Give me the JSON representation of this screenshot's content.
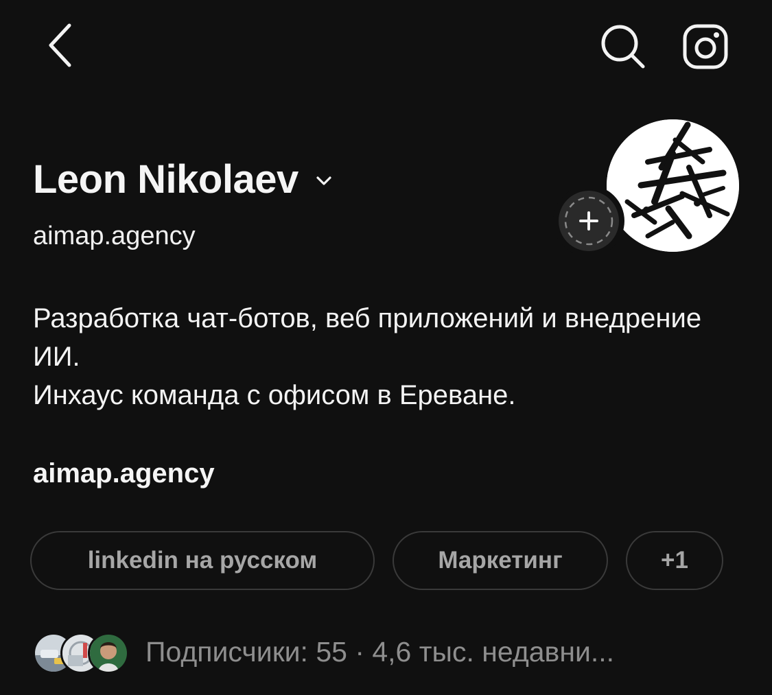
{
  "header": {
    "back_icon": "chevron-left-icon",
    "search_icon": "search-icon",
    "instagram_icon": "instagram-icon"
  },
  "profile": {
    "name": "Leon Nikolaev",
    "username": "aimap.agency",
    "add_story_icon": "plus-icon"
  },
  "bio": {
    "lines": [
      "Разработка чат-ботов, веб приложений и внедрение ИИ.",
      "Инхаус команда с офисом в Ереване."
    ],
    "link": "aimap.agency"
  },
  "chips": [
    {
      "label": "linkedin на русском"
    },
    {
      "label": "Маркетинг"
    },
    {
      "label": "+1"
    }
  ],
  "followers": {
    "text": "Подписчики: 55 · 4,6 тыс. недавни..."
  },
  "colors": {
    "background": "#101010",
    "text": "#f3f3f3",
    "muted": "#8e8e8e",
    "chip_border": "#3a3a3a"
  }
}
